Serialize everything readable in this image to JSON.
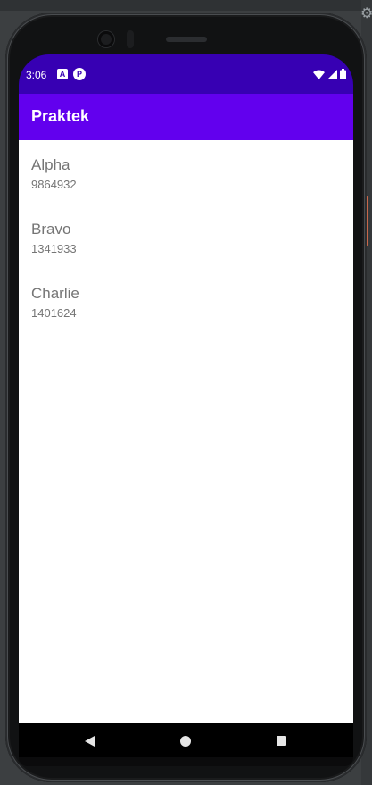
{
  "status_bar": {
    "time": "3:06",
    "icons": [
      "notification-a-icon",
      "notification-p-icon",
      "wifi-icon",
      "signal-icon",
      "battery-icon"
    ],
    "icon_a_glyph": "A",
    "icon_p_glyph": "P"
  },
  "app_bar": {
    "title": "Praktek"
  },
  "contacts": [
    {
      "name": "Alpha",
      "number": "9864932"
    },
    {
      "name": "Bravo",
      "number": "1341933"
    },
    {
      "name": "Charlie",
      "number": "1401624"
    }
  ],
  "nav_bar": {
    "icons": [
      "back-icon",
      "home-icon",
      "recents-icon"
    ]
  },
  "colors": {
    "status_bar": "#3700b3",
    "app_bar": "#6200ee",
    "list_text": "#757575",
    "background": "#ffffff"
  }
}
